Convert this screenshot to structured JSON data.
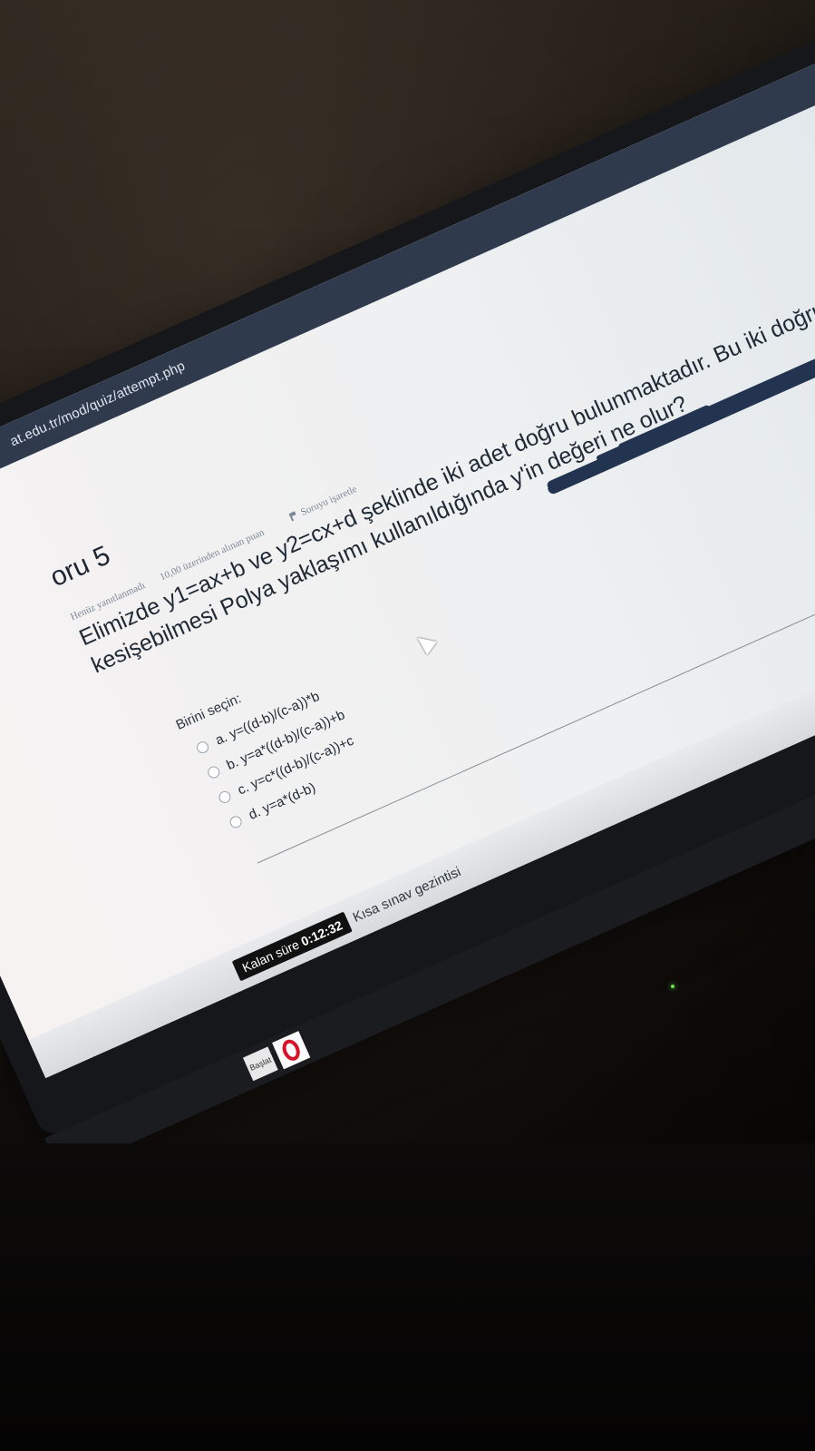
{
  "browser": {
    "url": "at.edu.tr/mod/quiz/attempt.php"
  },
  "question": {
    "title": "oru 5",
    "state": "Henüz yanıtlanmadı",
    "mark": "10,00 üzerinden alınan puan",
    "flag_label": "Soruyu işaretle",
    "text": "Elimizde y1=ax+b ve y2=cx+d şeklinde iki adet doğru bulunmaktadır. Bu iki doğrunun kesişebilmesi Polya yaklaşımı kullanıldığında y'in değeri ne olur?",
    "select_label": "Birini seçin:",
    "options": [
      {
        "label": "a. y=((d-b)/(c-a))*b"
      },
      {
        "label": "b. y=a*((d-b)/(c-a))+b"
      },
      {
        "label": "c. y=c*((d-b)/(c-a))+c"
      },
      {
        "label": "d. y=a*(d-b)"
      }
    ]
  },
  "footer": {
    "timer_label": "Kalan süre",
    "timer_value": "0:12:32",
    "nav_link": "Kısa sınav gezintisi"
  },
  "taskbar": {
    "start_label": "Başlat"
  }
}
